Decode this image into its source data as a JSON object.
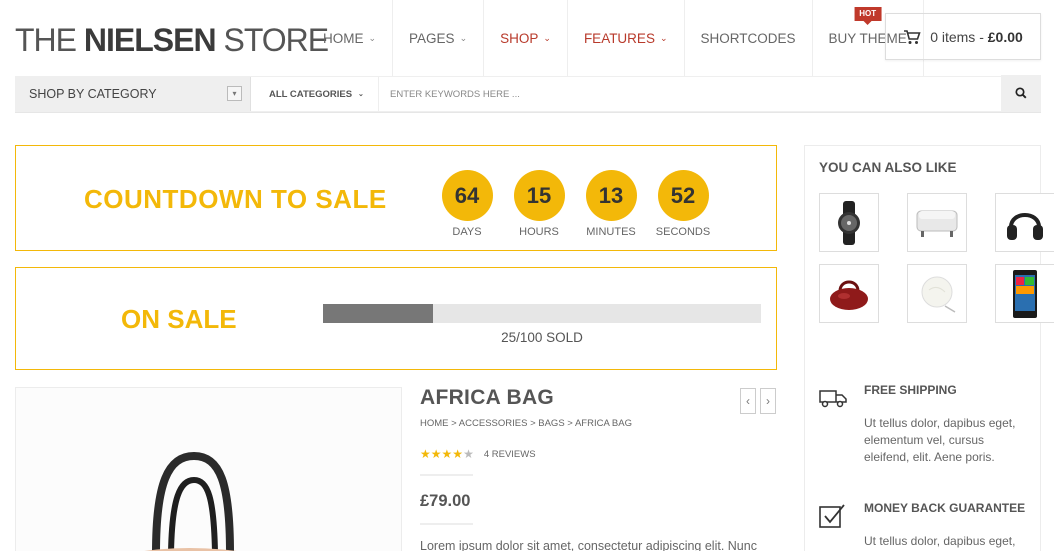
{
  "logo": {
    "part1": "THE ",
    "part2": "NIELSEN",
    "part3": " STORE"
  },
  "nav": [
    {
      "label": "HOME",
      "has_caret": true,
      "active": false
    },
    {
      "label": "PAGES",
      "has_caret": true,
      "active": false
    },
    {
      "label": "SHOP",
      "has_caret": true,
      "active": true
    },
    {
      "label": "FEATURES",
      "has_caret": true,
      "active": true
    },
    {
      "label": "SHORTCODES",
      "has_caret": false,
      "active": false
    },
    {
      "label": "BUY THEME",
      "has_caret": false,
      "active": false,
      "badge": "HOT"
    }
  ],
  "cart": {
    "count_text": "0 items - ",
    "total": "£0.00"
  },
  "search": {
    "shop_by_category": "SHOP BY CATEGORY",
    "all_categories": "ALL CATEGORIES",
    "placeholder": "ENTER KEYWORDS HERE ..."
  },
  "countdown": {
    "title": "COUNTDOWN TO SALE",
    "units": [
      {
        "value": "64",
        "label": "DAYS"
      },
      {
        "value": "15",
        "label": "HOURS"
      },
      {
        "value": "13",
        "label": "MINUTES"
      },
      {
        "value": "52",
        "label": "SECONDS"
      }
    ]
  },
  "on_sale": {
    "title": "ON SALE",
    "sold_text": "25/100 SOLD",
    "progress_fraction": 0.25
  },
  "product": {
    "name": "AFRICA BAG",
    "breadcrumb": "HOME > ACCESSORIES > BAGS > AFRICA BAG",
    "rating_stars": 4,
    "reviews": "4 REVIEWS",
    "price": "£79.00",
    "description": "Lorem ipsum dolor sit amet, consectetur adipiscing elit. Nunc"
  },
  "sidebar": {
    "title": "YOU CAN ALSO LIKE",
    "thumbnails": [
      "watch",
      "ottoman",
      "headphones",
      "handbag",
      "lamp",
      "smartphone"
    ],
    "services": [
      {
        "icon": "truck-icon",
        "title": "FREE SHIPPING",
        "text_lines": [
          "Ut tellus dolor, dapibus eget,",
          "elementum vel, cursus",
          "eleifend, elit. Aene poris."
        ]
      },
      {
        "icon": "checkbox-icon",
        "title": "MONEY BACK GUARANTEE",
        "text_lines": [
          "Ut tellus dolor, dapibus eget,"
        ]
      }
    ]
  },
  "colors": {
    "accent": "#f3b809",
    "nav_active": "#b83a2b",
    "hot_badge": "#c0392b"
  }
}
